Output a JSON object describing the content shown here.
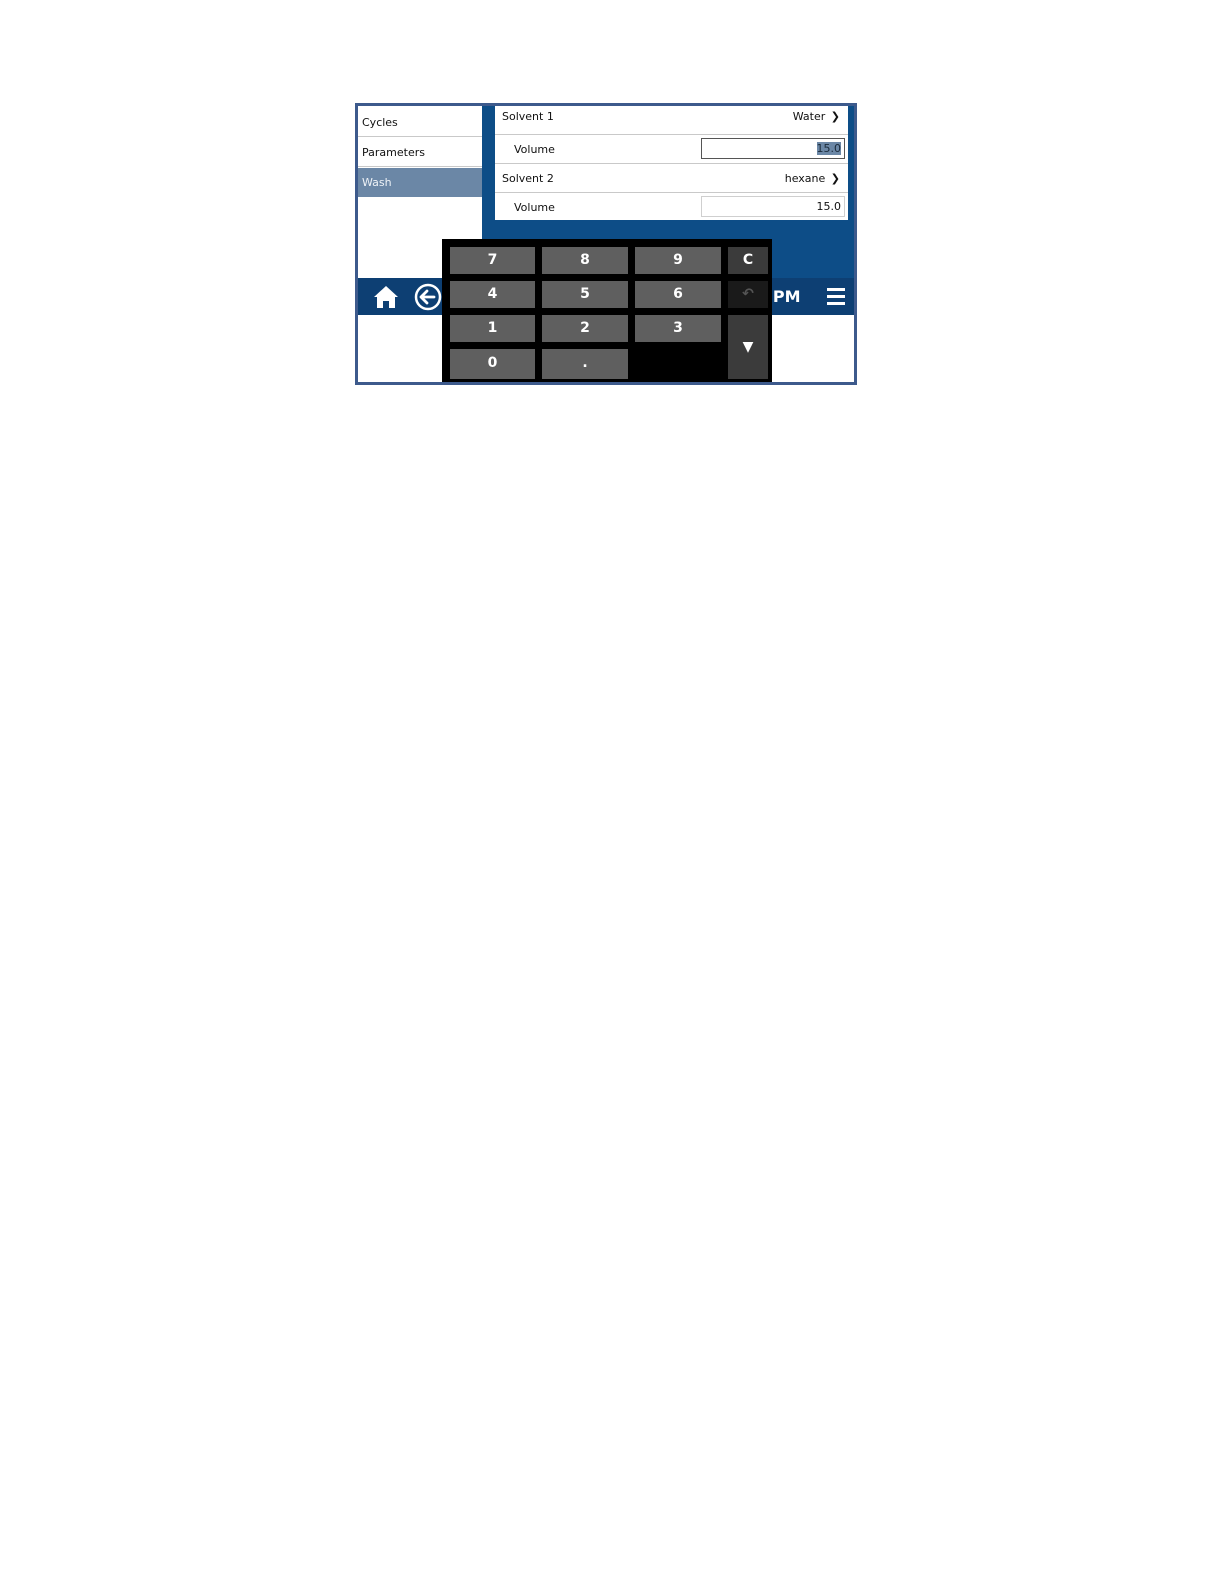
{
  "sidebar": {
    "items": [
      {
        "label": "Cycles"
      },
      {
        "label": "Parameters"
      },
      {
        "label": "Wash"
      }
    ],
    "active": "Wash"
  },
  "settings": {
    "solvent1": {
      "label": "Solvent 1",
      "value": "Water",
      "chevron": "❯"
    },
    "volume1": {
      "label": "Volume",
      "value": "15.0"
    },
    "solvent2": {
      "label": "Solvent 2",
      "value": "hexane",
      "chevron": "❯"
    },
    "volume2": {
      "label": "Volume",
      "value": "15.0"
    }
  },
  "bottom_bar": {
    "clock_partial": ") PM",
    "icons": [
      "home-icon",
      "back-arrow-icon",
      "menu-icon"
    ]
  },
  "keypad": {
    "keys": [
      "7",
      "8",
      "9",
      "C",
      "4",
      "5",
      "6",
      "1",
      "2",
      "3",
      "0",
      "."
    ],
    "undo": "↶",
    "down": "▼"
  },
  "colors": {
    "accent": "#0d4d87",
    "bar": "#0d3f73",
    "active_item": "#6b87a6",
    "frame": "#3d5a8c"
  }
}
